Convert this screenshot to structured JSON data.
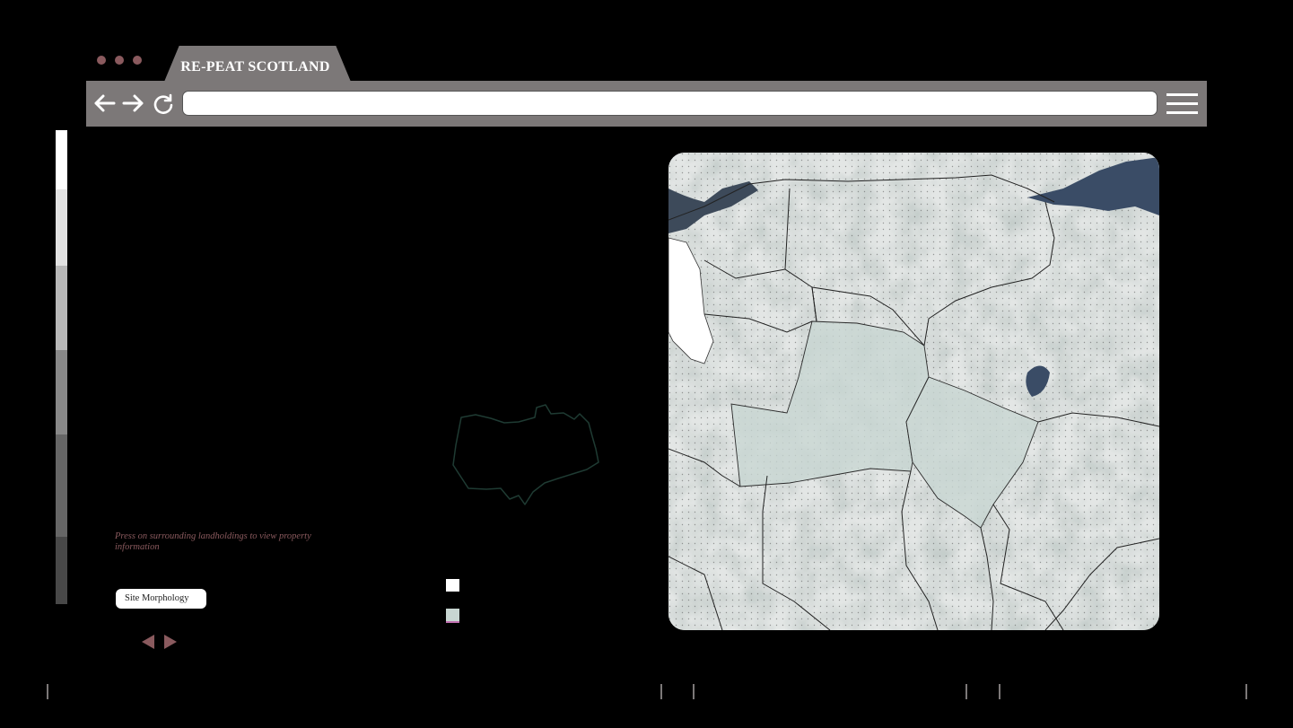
{
  "window": {
    "tab_title": "RE-PEAT SCOTLAND",
    "address": "",
    "icons": [
      "back-arrow-icon",
      "forward-arrow-icon",
      "reload-icon",
      "hamburger-menu-icon"
    ]
  },
  "sidebar": {
    "prompt": "Press on surrounding landholdings to view property information",
    "site_button_label": "Site Morphology"
  },
  "colors": {
    "chrome": "#7c7878",
    "accent": "#8a5a5e",
    "selected_parcel": "#c8d6d2",
    "background": "#000000"
  }
}
